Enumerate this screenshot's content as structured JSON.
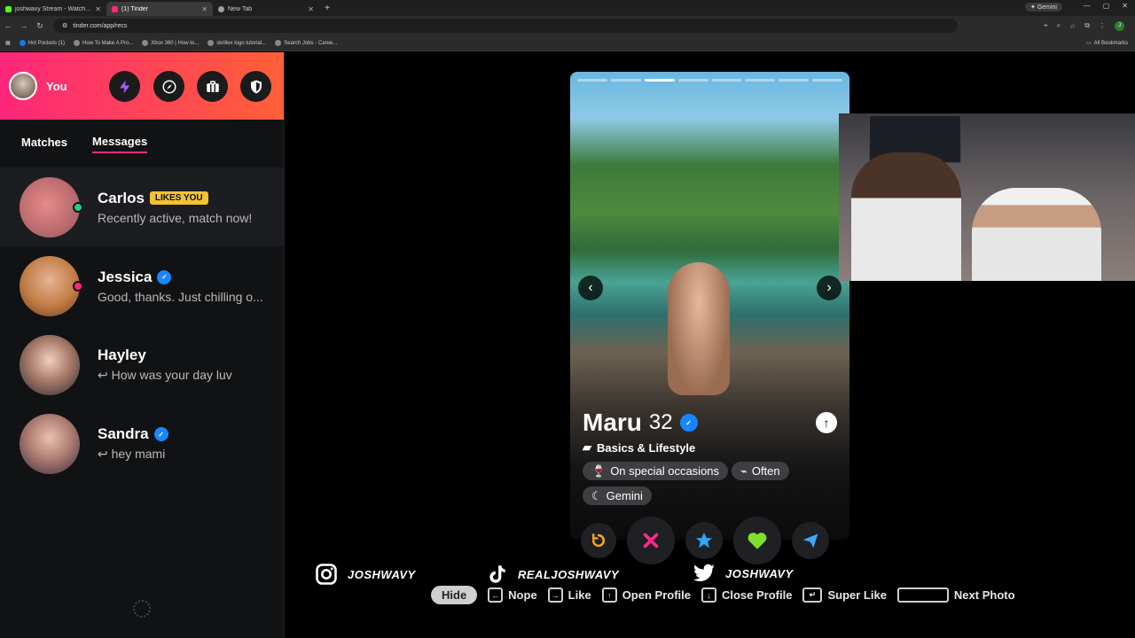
{
  "browser": {
    "tabs": [
      {
        "title": "joshwavy Stream - Watch Live o",
        "color": "#53fc18"
      },
      {
        "title": "(1) Tinder",
        "color": "#fd267a"
      },
      {
        "title": "New Tab",
        "color": "#9aa0a6"
      }
    ],
    "gemini_label": "Gemini",
    "url": "tinder.com/app/recs",
    "profile_initial": "J",
    "bookmarks": [
      "Hot Pockets (1)",
      "How To Make A Pro...",
      "Xbox 360 | How to...",
      "skrillex logo tutorial...",
      "Search Jobs - Caree..."
    ],
    "all_bookmarks": "All Bookmarks"
  },
  "sidebar": {
    "me_label": "You",
    "tabs": {
      "matches": "Matches",
      "messages": "Messages"
    },
    "conversations": [
      {
        "name": "Carlos",
        "badge": "LIKES YOU",
        "message": "Recently active, match now!"
      },
      {
        "name": "Jessica",
        "message": "Good, thanks. Just chilling o..."
      },
      {
        "name": "Hayley",
        "message": "How was your day luv"
      },
      {
        "name": "Sandra",
        "message": "hey mami"
      }
    ]
  },
  "card": {
    "name": "Maru",
    "age": "32",
    "section": "Basics & Lifestyle",
    "chips": [
      "On special occasions",
      "Often",
      "Gemini"
    ],
    "photo_count": 8,
    "current_photo": 3
  },
  "socials": [
    {
      "icon": "instagram-icon",
      "handle": "JOSHWAVY"
    },
    {
      "icon": "tiktok-icon",
      "handle": "REALJOSHWAVY"
    },
    {
      "icon": "twitter-icon",
      "handle": "JOSHWAVY"
    }
  ],
  "shortcuts": {
    "hide": "Hide",
    "nope": "Nope",
    "like": "Like",
    "open_profile": "Open Profile",
    "close_profile": "Close Profile",
    "super_like": "Super Like",
    "next_photo": "Next Photo"
  },
  "colors": {
    "brand_start": "#fd267a",
    "brand_end": "#ff6036",
    "badge": "#f2c230",
    "verified": "#1786ff"
  }
}
